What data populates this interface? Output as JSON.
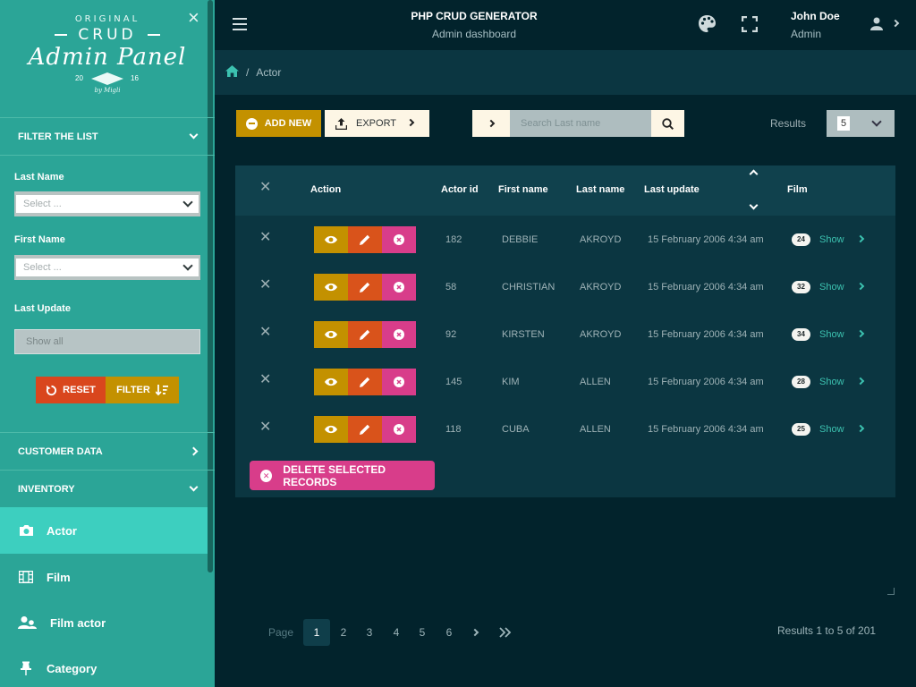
{
  "sidebar": {
    "logo": {
      "original": "ORIGINAL",
      "crud": "CRUD",
      "panel": "Admin Panel",
      "year_left": "20",
      "year_right": "16",
      "by": "by Migli"
    },
    "filter_section": "FILTER THE LIST",
    "filters": {
      "last_name_label": "Last Name",
      "last_name_value": "Select ...",
      "first_name_label": "First Name",
      "first_name_value": "Select ...",
      "last_update_label": "Last Update",
      "last_update_value": "Show all"
    },
    "reset_label": "RESET",
    "filter_label": "FILTER",
    "sections": {
      "customer_data": "CUSTOMER DATA",
      "inventory": "INVENTORY"
    },
    "nav": [
      {
        "label": "Actor",
        "icon": "camera-icon",
        "active": true
      },
      {
        "label": "Film",
        "icon": "film-icon",
        "active": false
      },
      {
        "label": "Film actor",
        "icon": "users-icon",
        "active": false
      },
      {
        "label": "Category",
        "icon": "pin-icon",
        "active": false
      }
    ]
  },
  "header": {
    "title": "PHP CRUD GENERATOR",
    "subtitle": "Admin dashboard",
    "user_name": "John Doe",
    "user_role": "Admin"
  },
  "breadcrumb": {
    "current": "Actor"
  },
  "toolbar": {
    "add_label": "ADD NEW",
    "export_label": "EXPORT",
    "search_placeholder": "Search Last name",
    "results_label": "Results",
    "results_value": "5"
  },
  "table": {
    "columns": [
      "Action",
      "Actor id",
      "First name",
      "Last name",
      "Last update",
      "Film"
    ],
    "show_label": "Show",
    "rows": [
      {
        "actor_id": "182",
        "first_name": "DEBBIE",
        "last_name": "AKROYD",
        "last_update": "15 February 2006 4:34 am",
        "film_count": "24"
      },
      {
        "actor_id": "58",
        "first_name": "CHRISTIAN",
        "last_name": "AKROYD",
        "last_update": "15 February 2006 4:34 am",
        "film_count": "32"
      },
      {
        "actor_id": "92",
        "first_name": "KIRSTEN",
        "last_name": "AKROYD",
        "last_update": "15 February 2006 4:34 am",
        "film_count": "34"
      },
      {
        "actor_id": "145",
        "first_name": "KIM",
        "last_name": "ALLEN",
        "last_update": "15 February 2006 4:34 am",
        "film_count": "28"
      },
      {
        "actor_id": "118",
        "first_name": "CUBA",
        "last_name": "ALLEN",
        "last_update": "15 February 2006 4:34 am",
        "film_count": "25"
      }
    ],
    "delete_selected_label": "DELETE SELECTED RECORDS"
  },
  "pagination": {
    "page_label": "Page",
    "pages": [
      "1",
      "2",
      "3",
      "4",
      "5",
      "6"
    ],
    "current": "1",
    "summary": "Results 1 to 5 of 201"
  },
  "colors": {
    "sidebar": "#2ba597",
    "sidebar_active": "#3dcfbf",
    "background": "#02232c",
    "panel": "#0b3641",
    "view": "#c39100",
    "edit": "#d9531b",
    "delete": "#d83d8a",
    "accent": "#3cc2b0"
  }
}
